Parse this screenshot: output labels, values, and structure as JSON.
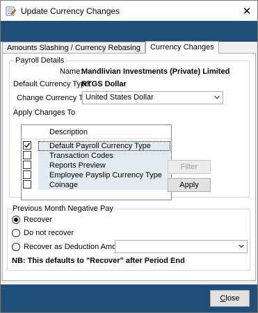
{
  "window": {
    "title": "Update Currency Changes",
    "close_glyph": "✕",
    "title_icon": "edit-form-icon"
  },
  "tabs": [
    {
      "label": "Amounts Slashing / Currency Rebasing",
      "active": false
    },
    {
      "label": "Currency Changes",
      "active": true
    }
  ],
  "payroll_details": {
    "legend": "Payroll Details",
    "name_label": "Name:",
    "name_value": "Mandlivian Investments (Private) Limited",
    "default_currency_label": "Default Currency Type:",
    "default_currency_value": "RTGS Dollar",
    "change_currency_label": "Change Currency To:",
    "change_currency_value": "United States Dollar",
    "apply_changes_label": "Apply Changes To",
    "list_header": "Description",
    "items": [
      {
        "label": "Default Payroll Currency Type",
        "checked": true
      },
      {
        "label": "Transaction Codes",
        "checked": false
      },
      {
        "label": "Reports Preview",
        "checked": false
      },
      {
        "label": "Employee Payslip Currency Type",
        "checked": false
      },
      {
        "label": "Coinage",
        "checked": false
      }
    ],
    "filter_button": "Filter",
    "apply_button": "Apply"
  },
  "negative_pay": {
    "legend": "Previous Month Negative Pay",
    "options": [
      {
        "label": "Recover",
        "selected": true
      },
      {
        "label": "Do not recover",
        "selected": false
      },
      {
        "label": "Recover as Deduction Amount",
        "selected": false
      }
    ],
    "deduction_amount_value": "",
    "note": "NB: This defaults to \"Recover\" after Period End"
  },
  "footer": {
    "close_button": "Close"
  },
  "colors": {
    "band": "#1f4e79",
    "row_highlight": "#e3ebf2"
  }
}
